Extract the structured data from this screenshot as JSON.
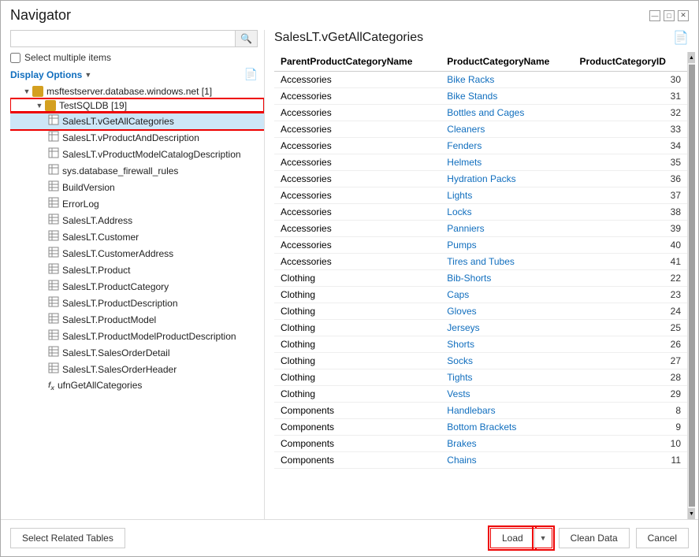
{
  "window": {
    "title": "Navigator"
  },
  "search": {
    "placeholder": "",
    "value": ""
  },
  "checkboxes": {
    "select_multiple": "Select multiple items"
  },
  "display_options": {
    "label": "Display Options",
    "chevron": "▼"
  },
  "tree": {
    "server_node": "msftestserver.database.windows.net [1]",
    "db_node": "TestSQLDB [19]",
    "items": [
      {
        "label": "SalesLT.vGetAllCategories",
        "type": "view",
        "selected": true
      },
      {
        "label": "SalesLT.vProductAndDescription",
        "type": "view"
      },
      {
        "label": "SalesLT.vProductModelCatalogDescription",
        "type": "view"
      },
      {
        "label": "sys.database_firewall_rules",
        "type": "view"
      },
      {
        "label": "BuildVersion",
        "type": "table"
      },
      {
        "label": "ErrorLog",
        "type": "table"
      },
      {
        "label": "SalesLT.Address",
        "type": "table"
      },
      {
        "label": "SalesLT.Customer",
        "type": "table"
      },
      {
        "label": "SalesLT.CustomerAddress",
        "type": "table"
      },
      {
        "label": "SalesLT.Product",
        "type": "table"
      },
      {
        "label": "SalesLT.ProductCategory",
        "type": "table"
      },
      {
        "label": "SalesLT.ProductDescription",
        "type": "table"
      },
      {
        "label": "SalesLT.ProductModel",
        "type": "table"
      },
      {
        "label": "SalesLT.ProductModelProductDescription",
        "type": "table"
      },
      {
        "label": "SalesLT.SalesOrderDetail",
        "type": "table"
      },
      {
        "label": "SalesLT.SalesOrderHeader",
        "type": "table"
      },
      {
        "label": "ufnGetAllCategories",
        "type": "func"
      }
    ]
  },
  "right_panel": {
    "title": "SalesLT.vGetAllCategories",
    "columns": [
      {
        "key": "parent",
        "label": "ParentProductCategoryName"
      },
      {
        "key": "product",
        "label": "ProductCategoryName"
      },
      {
        "key": "id",
        "label": "ProductCategoryID"
      }
    ],
    "rows": [
      {
        "parent": "Accessories",
        "product": "Bike Racks",
        "id": "30"
      },
      {
        "parent": "Accessories",
        "product": "Bike Stands",
        "id": "31"
      },
      {
        "parent": "Accessories",
        "product": "Bottles and Cages",
        "id": "32"
      },
      {
        "parent": "Accessories",
        "product": "Cleaners",
        "id": "33"
      },
      {
        "parent": "Accessories",
        "product": "Fenders",
        "id": "34"
      },
      {
        "parent": "Accessories",
        "product": "Helmets",
        "id": "35"
      },
      {
        "parent": "Accessories",
        "product": "Hydration Packs",
        "id": "36"
      },
      {
        "parent": "Accessories",
        "product": "Lights",
        "id": "37"
      },
      {
        "parent": "Accessories",
        "product": "Locks",
        "id": "38"
      },
      {
        "parent": "Accessories",
        "product": "Panniers",
        "id": "39"
      },
      {
        "parent": "Accessories",
        "product": "Pumps",
        "id": "40"
      },
      {
        "parent": "Accessories",
        "product": "Tires and Tubes",
        "id": "41"
      },
      {
        "parent": "Clothing",
        "product": "Bib-Shorts",
        "id": "22"
      },
      {
        "parent": "Clothing",
        "product": "Caps",
        "id": "23"
      },
      {
        "parent": "Clothing",
        "product": "Gloves",
        "id": "24"
      },
      {
        "parent": "Clothing",
        "product": "Jerseys",
        "id": "25"
      },
      {
        "parent": "Clothing",
        "product": "Shorts",
        "id": "26"
      },
      {
        "parent": "Clothing",
        "product": "Socks",
        "id": "27"
      },
      {
        "parent": "Clothing",
        "product": "Tights",
        "id": "28"
      },
      {
        "parent": "Clothing",
        "product": "Vests",
        "id": "29"
      },
      {
        "parent": "Components",
        "product": "Handlebars",
        "id": "8"
      },
      {
        "parent": "Components",
        "product": "Bottom Brackets",
        "id": "9"
      },
      {
        "parent": "Components",
        "product": "Brakes",
        "id": "10"
      },
      {
        "parent": "Components",
        "product": "Chains",
        "id": "11"
      }
    ]
  },
  "bottom": {
    "select_related_label": "Select Related Tables",
    "load_label": "Load",
    "load_arrow": "▼",
    "clean_data_label": "Clean Data",
    "cancel_label": "Cancel"
  }
}
